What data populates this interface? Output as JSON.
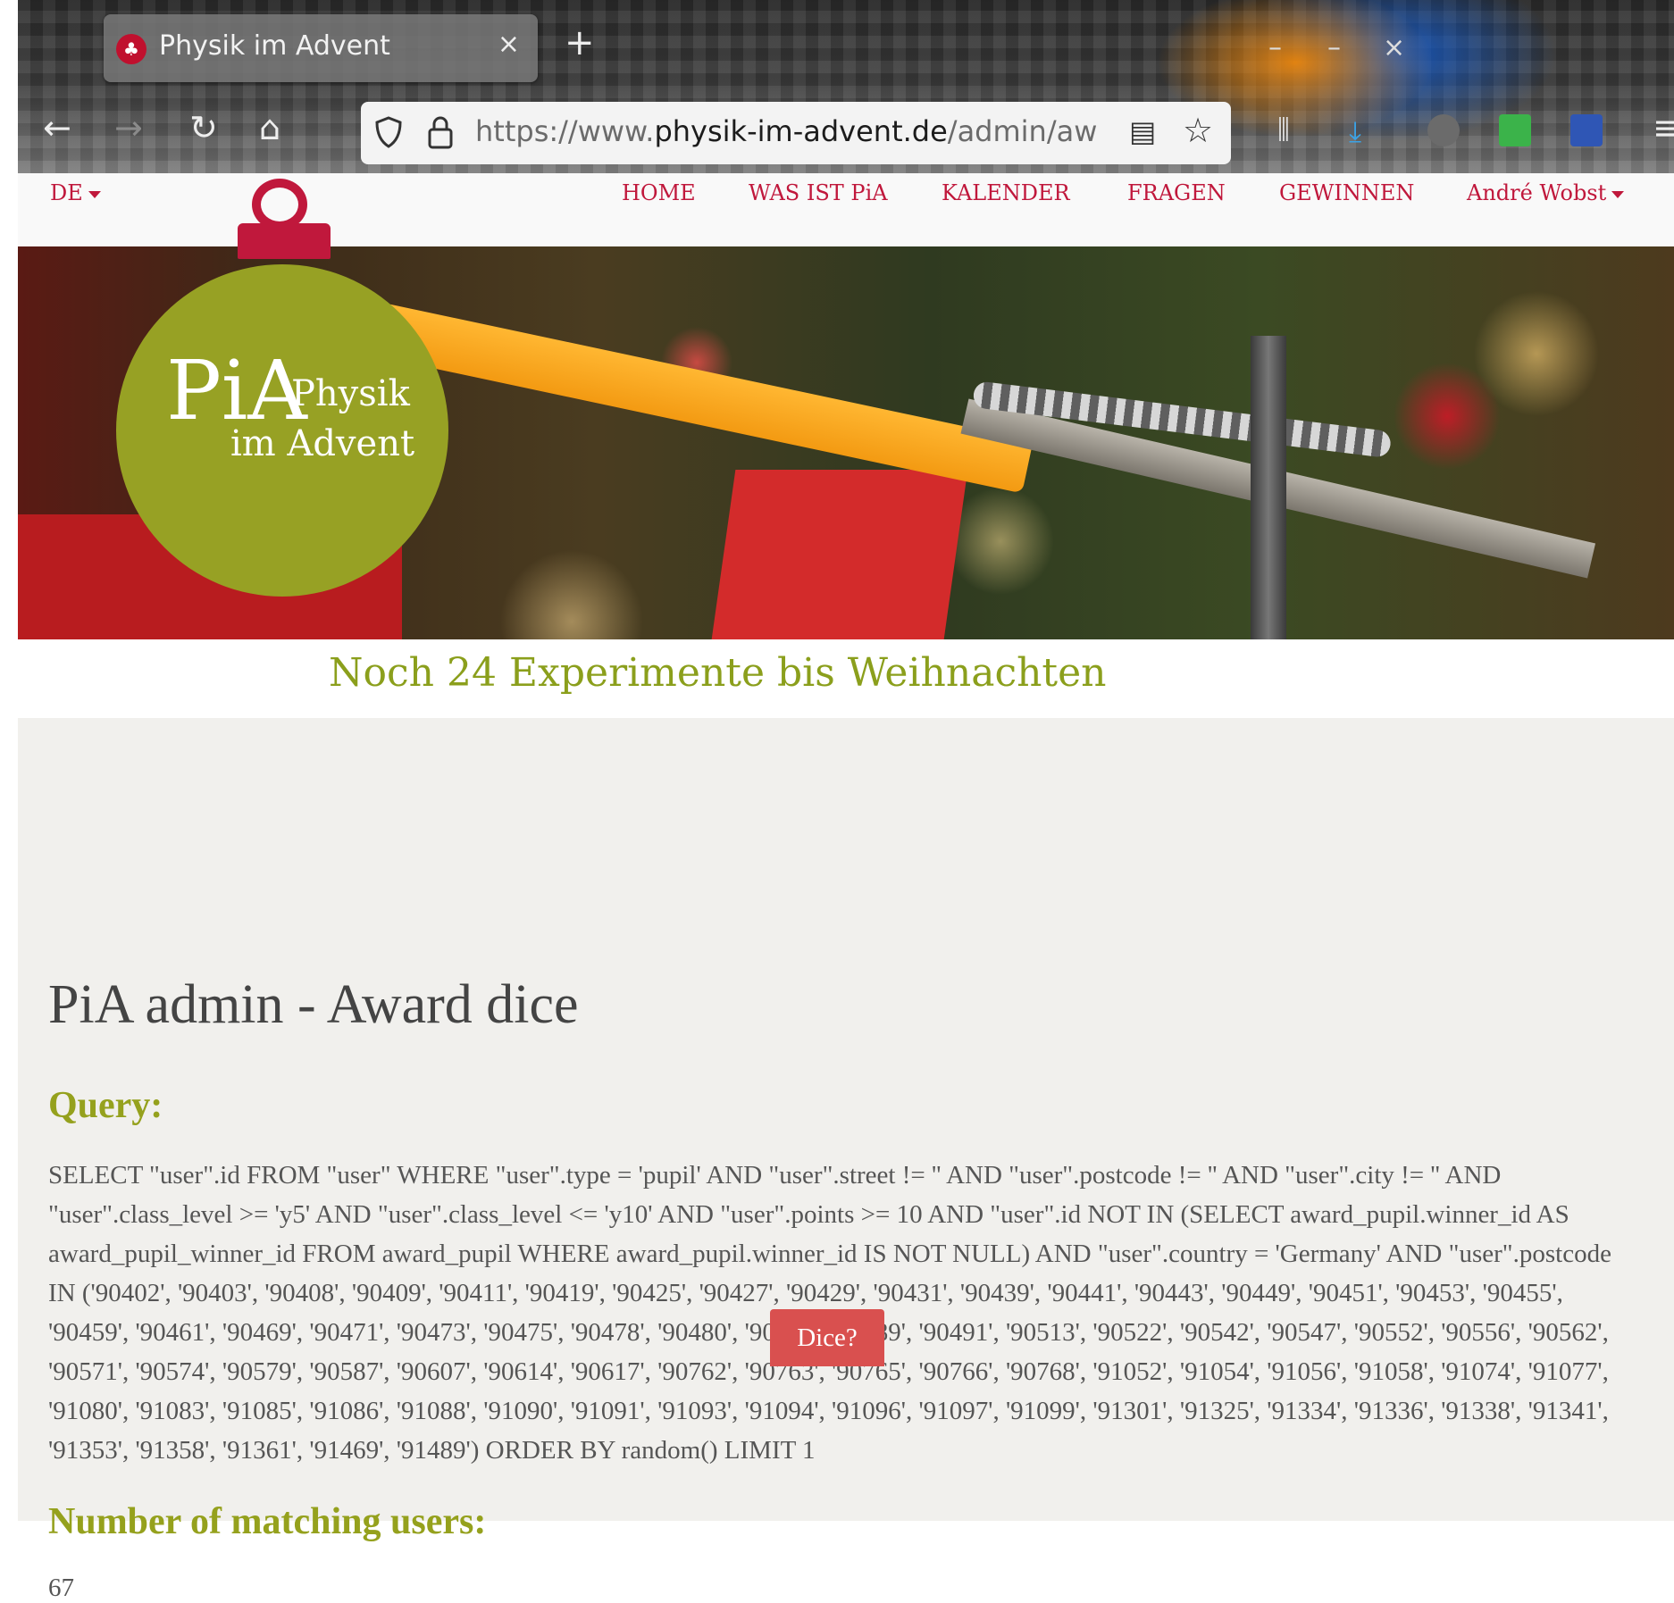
{
  "browser": {
    "tab_title": "Physik im Advent",
    "tab_close": "×",
    "new_tab": "+",
    "url_prefix": "https://www.",
    "url_host": "physik-im-advent.de",
    "url_path": "/admin/aw",
    "window_controls": {
      "minimize": "–",
      "restore": "–",
      "close": "×"
    }
  },
  "nav": {
    "language": "DE",
    "items": [
      "HOME",
      "WAS IST PiA",
      "KALENDER",
      "FRAGEN",
      "GEWINNEN"
    ],
    "user": "André Wobst"
  },
  "logo": {
    "pia": "PiA",
    "physik": "Physik",
    "advent": "im Advent"
  },
  "countdown": "Noch 24 Experimente bis Weihnachten",
  "main": {
    "title": "PiA admin - Award dice",
    "query_heading": "Query:",
    "query": "SELECT \"user\".id FROM \"user\" WHERE \"user\".type = 'pupil' AND \"user\".street != '' AND \"user\".postcode != '' AND \"user\".city != '' AND \"user\".class_level >= 'y5' AND \"user\".class_level <= 'y10' AND \"user\".points >= 10 AND \"user\".id NOT IN (SELECT award_pupil.winner_id AS award_pupil_winner_id FROM award_pupil WHERE award_pupil.winner_id IS NOT NULL) AND \"user\".country = 'Germany' AND \"user\".postcode IN ('90402', '90403', '90408', '90409', '90411', '90419', '90425', '90427', '90429', '90431', '90439', '90441', '90443', '90449', '90451', '90453', '90455', '90459', '90461', '90469', '90471', '90473', '90475', '90478', '90480', '90482', '90489', '90491', '90513', '90522', '90542', '90547', '90552', '90556', '90562', '90571', '90574', '90579', '90587', '90607', '90614', '90617', '90762', '90763', '90765', '90766', '90768', '91052', '91054', '91056', '91058', '91074', '91077', '91080', '91083', '91085', '91086', '91088', '91090', '91091', '91093', '91094', '91096', '91097', '91099', '91301', '91325', '91334', '91336', '91338', '91341', '91353', '91358', '91361', '91469', '91489') ORDER BY random() LIMIT 1",
    "count_heading": "Number of matching users:",
    "count": "67",
    "dice_label": "Dice?"
  },
  "colors": {
    "accent_red": "#c0183c",
    "accent_green": "#95a11d",
    "button_red": "#d9504f",
    "page_bg": "#f1f0ed"
  },
  "icons": [
    "firefox-favicon",
    "back-icon",
    "forward-icon",
    "reload-icon",
    "home-icon",
    "shield-icon",
    "lock-icon",
    "reader-icon",
    "bookmark-star-icon",
    "library-icon",
    "download-icon",
    "ublock-icon",
    "extension-icon",
    "extension-search-icon",
    "menu-icon"
  ]
}
